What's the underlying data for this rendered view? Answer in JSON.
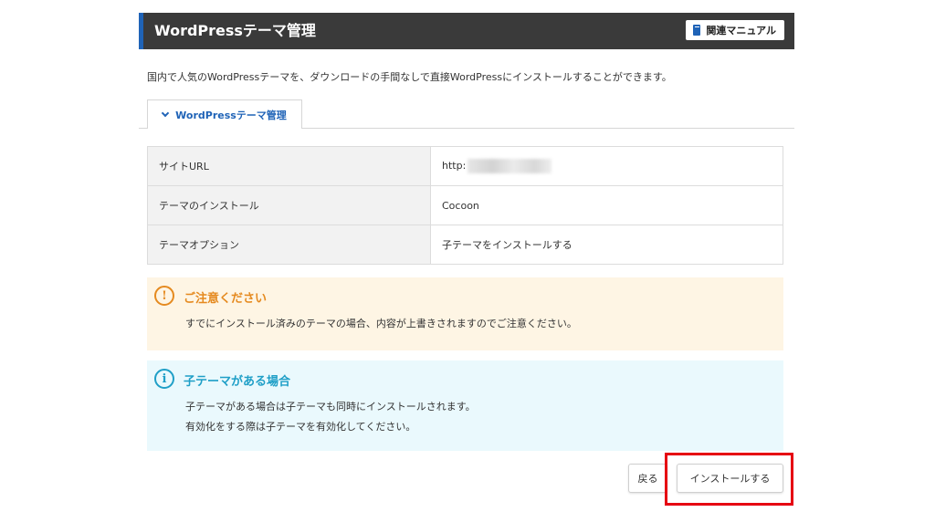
{
  "header": {
    "title": "WordPressテーマ管理",
    "manual_button": "関連マニュアル"
  },
  "intro": "国内で人気のWordPressテーマを、ダウンロードの手間なしで直接WordPressにインストールすることができます。",
  "tab": {
    "label": "WordPressテーマ管理"
  },
  "settings": [
    {
      "label": "サイトURL",
      "value": "http:"
    },
    {
      "label": "テーマのインストール",
      "value": "Cocoon"
    },
    {
      "label": "テーマオプション",
      "value": "子テーマをインストールする"
    }
  ],
  "warning": {
    "title": "ご注意ください",
    "text": "すでにインストール済みのテーマの場合、内容が上書きされますのでご注意ください。"
  },
  "info": {
    "title": "子テーマがある場合",
    "line1": "子テーマがある場合は子テーマも同時にインストールされます。",
    "line2": "有効化をする際は子テーマを有効化してください。"
  },
  "buttons": {
    "back": "戻る",
    "install": "インストールする"
  },
  "colors": {
    "accent_blue": "#1f63b7",
    "header_bg": "#3a3a3a",
    "warning": "#e58a1f",
    "info": "#1f9fc7",
    "highlight": "#e60012"
  }
}
